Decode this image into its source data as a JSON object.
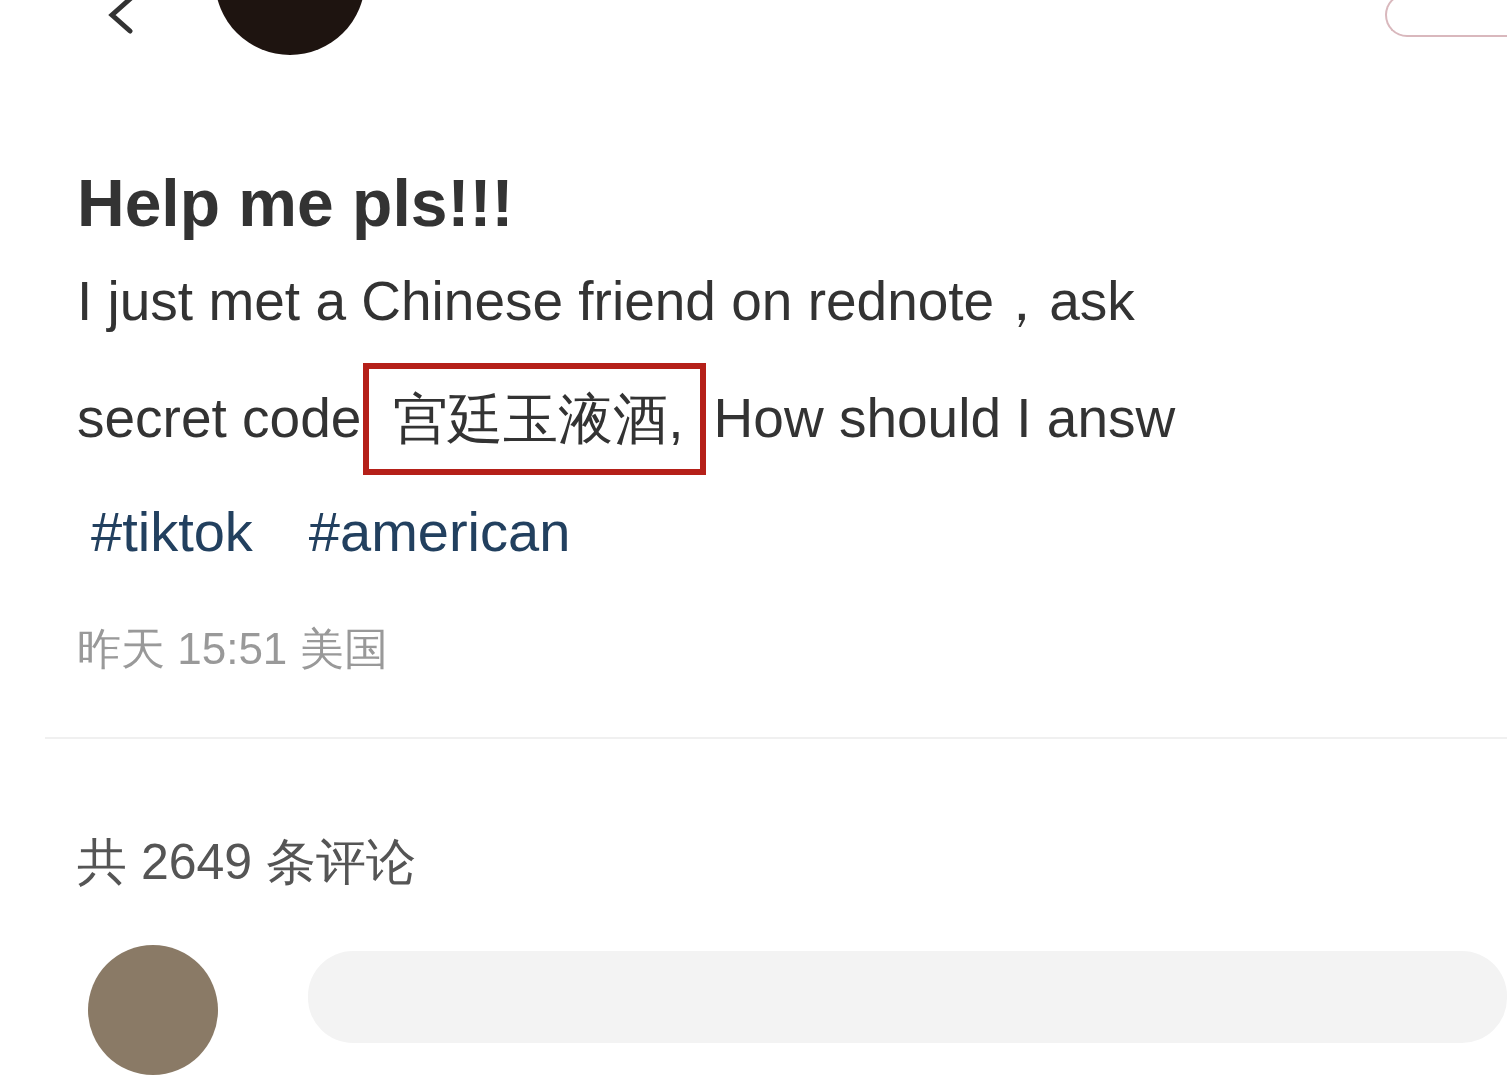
{
  "post": {
    "title": "Help me pls!!!",
    "line_1": "I just met a Chinese friend on rednote，ask",
    "line_2_before": "secret code",
    "highlight": "宫廷玉液酒,",
    "line_2_after": "How should I answ",
    "hashtags": [
      "#tiktok",
      "#american"
    ],
    "meta": "昨天 15:51 美国"
  },
  "comments": {
    "count": "共 2649 条评论"
  }
}
